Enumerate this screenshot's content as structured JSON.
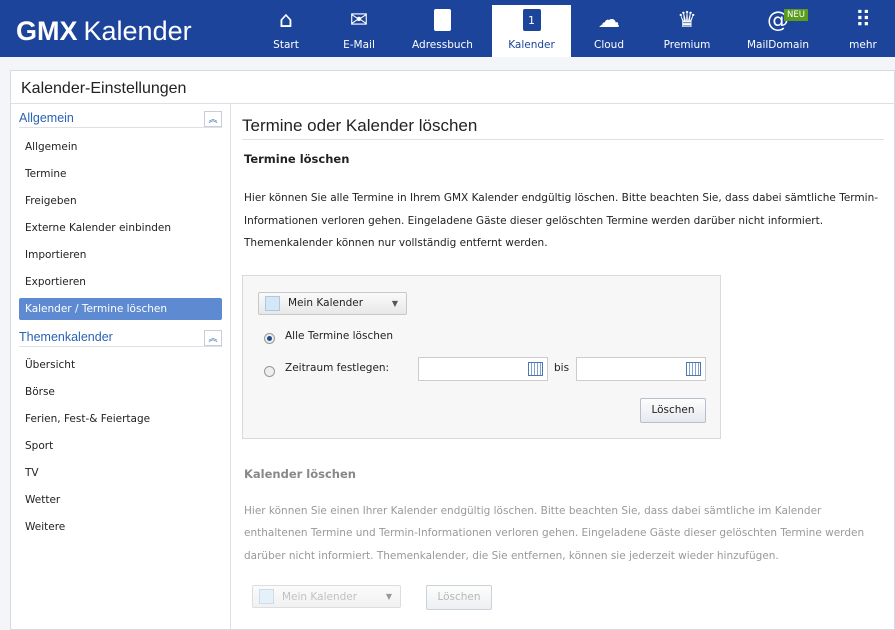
{
  "header": {
    "brand": "GMX",
    "product": "Kalender",
    "nav": [
      {
        "label": "Start",
        "icon": "home-icon"
      },
      {
        "label": "E-Mail",
        "icon": "mail-icon"
      },
      {
        "label": "Adressbuch",
        "icon": "addressbook-icon"
      },
      {
        "label": "Kalender",
        "icon": "calendar-icon",
        "day": "1"
      },
      {
        "label": "Cloud",
        "icon": "cloud-icon"
      },
      {
        "label": "Premium",
        "icon": "crown-icon"
      },
      {
        "label": "MailDomain",
        "icon": "maildomain-icon",
        "badge": "NEU"
      },
      {
        "label": "mehr",
        "icon": "grid-icon"
      }
    ]
  },
  "page_title": "Kalender-Einstellungen",
  "sidebar": {
    "groups": [
      {
        "title": "Allgemein",
        "items": [
          "Allgemein",
          "Termine",
          "Freigeben",
          "Externe Kalender einbinden",
          "Importieren",
          "Exportieren",
          "Kalender / Termine löschen"
        ]
      },
      {
        "title": "Themenkalender",
        "items": [
          "Übersicht",
          "Börse",
          "Ferien, Fest-& Feiertage",
          "Sport",
          "TV",
          "Wetter",
          "Weitere"
        ]
      }
    ],
    "active": "Kalender / Termine löschen"
  },
  "main": {
    "title": "Termine oder Kalender löschen",
    "termine": {
      "heading": "Termine löschen",
      "text": "Hier können Sie alle Termine in Ihrem GMX Kalender endgültig löschen. Bitte beachten Sie, dass dabei sämtliche Termin-Informationen verloren gehen. Eingeladene Gäste dieser gelöschten Termine werden darüber nicht informiert. Themenkalender können nur vollständig entfernt werden.",
      "calendar_select": "Mein Kalender",
      "radio_all": "Alle Termine löschen",
      "radio_range": "Zeitraum festlegen:",
      "from_value": "",
      "to_label": "bis",
      "to_value": "",
      "delete_button": "Löschen"
    },
    "kalender": {
      "heading": "Kalender löschen",
      "text": "Hier können Sie einen Ihrer Kalender endgültig löschen. Bitte beachten Sie, dass dabei sämtliche im Kalender enthaltenen Termine und Termin-Informationen verloren gehen. Eingeladene Gäste dieser gelöschten Termine werden darüber nicht informiert. Themenkalender, die Sie entfernen, können sie jederzeit wieder hinzufügen.",
      "calendar_select": "Mein Kalender",
      "delete_button": "Löschen"
    }
  }
}
